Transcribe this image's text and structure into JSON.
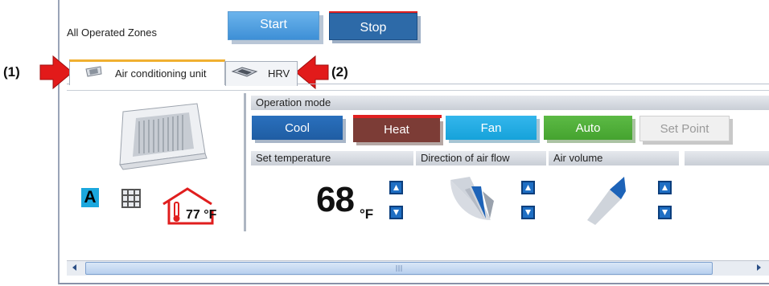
{
  "header": {
    "zones_label": "All Operated Zones",
    "start_label": "Start",
    "stop_label": "Stop"
  },
  "tabs": [
    {
      "label": "Air conditioning unit",
      "icon": "ceiling-cassette-icon",
      "active": true
    },
    {
      "label": "HRV",
      "icon": "hrv-unit-icon",
      "active": false
    }
  ],
  "annotations": {
    "left": "(1)",
    "right": "(2)"
  },
  "unit_panel": {
    "unit_image": "ceiling-cassette-unit-image",
    "status_icons": [
      {
        "name": "auto-mode-icon",
        "text": "A"
      },
      {
        "name": "grid-filter-icon"
      },
      {
        "name": "room-temperature-icon"
      }
    ],
    "room_temp": "77 °F"
  },
  "operation": {
    "header": "Operation mode",
    "modes": [
      "Cool",
      "Heat",
      "Fan",
      "Auto",
      "Set Point"
    ],
    "selected": "Heat"
  },
  "settings": {
    "set_temp_header": "Set temperature",
    "airflow_header": "Direction of air flow",
    "volume_header": "Air volume",
    "temp_value": "68",
    "temp_unit": "°F"
  },
  "colors": {
    "accent_blue": "#2a70bd",
    "heat": "#7c3c36",
    "fan": "#1ba7dd",
    "auto": "#52b23c",
    "stop_bar": "#e02020",
    "arrow_red": "#e21a1a"
  }
}
